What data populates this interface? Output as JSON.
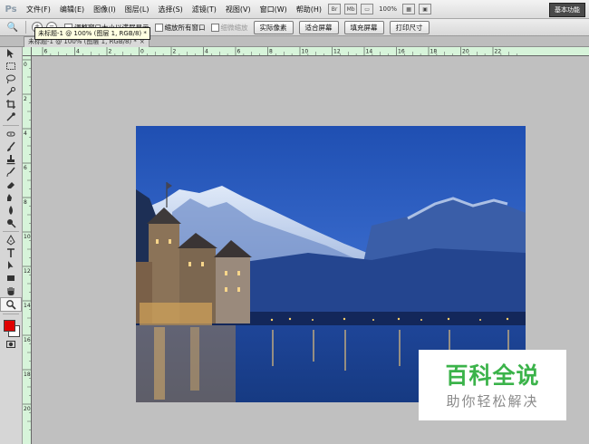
{
  "app": {
    "logo": "Ps"
  },
  "menu": [
    {
      "label": "文件(F)"
    },
    {
      "label": "编辑(E)"
    },
    {
      "label": "图像(I)"
    },
    {
      "label": "图层(L)"
    },
    {
      "label": "选择(S)"
    },
    {
      "label": "滤镜(T)"
    },
    {
      "label": "视图(V)"
    },
    {
      "label": "窗口(W)"
    },
    {
      "label": "帮助(H)"
    }
  ],
  "menubar": {
    "bridge_icon": "Br",
    "mini_bridge_icon": "Mb",
    "zoom": "100%",
    "workspace": "基本功能"
  },
  "options": {
    "checkbox_resize": "调整窗口大小以满屏显示",
    "checkbox_all_windows": "缩放所有窗口",
    "checkbox_scrubby": "细微缩放",
    "btn_actual_pixels": "实际像素",
    "btn_fit_screen": "适合屏幕",
    "btn_fill_screen": "填充屏幕",
    "btn_print_size": "打印尺寸"
  },
  "tooltip": "未标题-1 @ 100% (图层 1, RGB/8) *",
  "document_tab": {
    "title": "未标题-1 @ 100% (图层 1, RGB/8) *",
    "close": "×"
  },
  "ruler": {
    "top_labels": [
      "6",
      "4",
      "2",
      "0",
      "2",
      "4",
      "6",
      "8",
      "10",
      "12",
      "14",
      "16",
      "18",
      "20",
      "22"
    ],
    "left_labels": [
      "0",
      "2",
      "4",
      "6",
      "8",
      "10",
      "12",
      "14",
      "16",
      "18",
      "20"
    ]
  },
  "colors": {
    "foreground": "#e00000",
    "background": "#ffffff",
    "watermark_green": "#3bb34a"
  },
  "watermark": {
    "title": "百科全说",
    "subtitle": "助你轻松解决"
  }
}
